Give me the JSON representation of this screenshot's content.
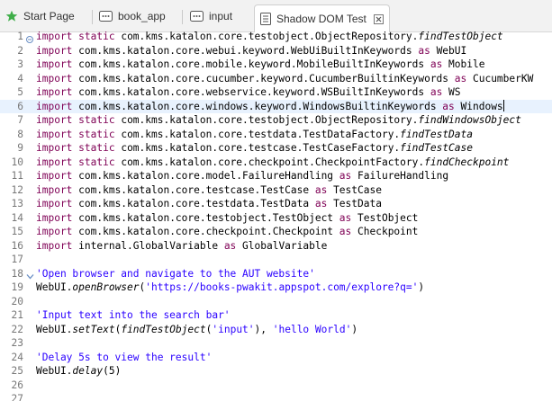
{
  "tabs": [
    {
      "label": "Start Page",
      "icon": "star-icon"
    },
    {
      "label": "book_app",
      "icon": "object-repository-icon"
    },
    {
      "label": "input",
      "icon": "test-object-icon"
    },
    {
      "label": "Shadow DOM Test",
      "icon": "test-case-icon",
      "active": true,
      "close_icon": "close-icon"
    }
  ],
  "editor": {
    "current_line": 6,
    "lines": [
      {
        "n": "1",
        "fold": "collapse",
        "tokens": [
          {
            "t": "import",
            "k": "kw"
          },
          {
            "t": " "
          },
          {
            "t": "static",
            "k": "kw"
          },
          {
            "t": " com.kms.katalon.core.testobject.ObjectRepository."
          },
          {
            "t": "findTestObject",
            "k": "it"
          }
        ]
      },
      {
        "n": "2",
        "tokens": [
          {
            "t": "import",
            "k": "kw"
          },
          {
            "t": " com.kms.katalon.core.webui.keyword.WebUiBuiltInKeywords "
          },
          {
            "t": "as",
            "k": "kw"
          },
          {
            "t": " WebUI"
          }
        ]
      },
      {
        "n": "3",
        "tokens": [
          {
            "t": "import",
            "k": "kw"
          },
          {
            "t": " com.kms.katalon.core.mobile.keyword.MobileBuiltInKeywords "
          },
          {
            "t": "as",
            "k": "kw"
          },
          {
            "t": " Mobile"
          }
        ]
      },
      {
        "n": "4",
        "tokens": [
          {
            "t": "import",
            "k": "kw"
          },
          {
            "t": " com.kms.katalon.core.cucumber.keyword.CucumberBuiltinKeywords "
          },
          {
            "t": "as",
            "k": "kw"
          },
          {
            "t": " CucumberKW"
          }
        ]
      },
      {
        "n": "5",
        "tokens": [
          {
            "t": "import",
            "k": "kw"
          },
          {
            "t": " com.kms.katalon.core.webservice.keyword.WSBuiltInKeywords "
          },
          {
            "t": "as",
            "k": "kw"
          },
          {
            "t": " WS"
          }
        ]
      },
      {
        "n": "6",
        "caret": true,
        "tokens": [
          {
            "t": "import",
            "k": "kw"
          },
          {
            "t": " com.kms.katalon.core.windows.keyword.WindowsBuiltinKeywords "
          },
          {
            "t": "as",
            "k": "kw"
          },
          {
            "t": " Windows"
          }
        ]
      },
      {
        "n": "7",
        "tokens": [
          {
            "t": "import",
            "k": "kw"
          },
          {
            "t": " "
          },
          {
            "t": "static",
            "k": "kw"
          },
          {
            "t": " com.kms.katalon.core.testobject.ObjectRepository."
          },
          {
            "t": "findWindowsObject",
            "k": "it"
          }
        ]
      },
      {
        "n": "8",
        "tokens": [
          {
            "t": "import",
            "k": "kw"
          },
          {
            "t": " "
          },
          {
            "t": "static",
            "k": "kw"
          },
          {
            "t": " com.kms.katalon.core.testdata.TestDataFactory."
          },
          {
            "t": "findTestData",
            "k": "it"
          }
        ]
      },
      {
        "n": "9",
        "tokens": [
          {
            "t": "import",
            "k": "kw"
          },
          {
            "t": " "
          },
          {
            "t": "static",
            "k": "kw"
          },
          {
            "t": " com.kms.katalon.core.testcase.TestCaseFactory."
          },
          {
            "t": "findTestCase",
            "k": "it"
          }
        ]
      },
      {
        "n": "10",
        "tokens": [
          {
            "t": "import",
            "k": "kw"
          },
          {
            "t": " "
          },
          {
            "t": "static",
            "k": "kw"
          },
          {
            "t": " com.kms.katalon.core.checkpoint.CheckpointFactory."
          },
          {
            "t": "findCheckpoint",
            "k": "it"
          }
        ]
      },
      {
        "n": "11",
        "tokens": [
          {
            "t": "import",
            "k": "kw"
          },
          {
            "t": " com.kms.katalon.core.model.FailureHandling "
          },
          {
            "t": "as",
            "k": "kw"
          },
          {
            "t": " FailureHandling"
          }
        ]
      },
      {
        "n": "12",
        "tokens": [
          {
            "t": "import",
            "k": "kw"
          },
          {
            "t": " com.kms.katalon.core.testcase.TestCase "
          },
          {
            "t": "as",
            "k": "kw"
          },
          {
            "t": " TestCase"
          }
        ]
      },
      {
        "n": "13",
        "tokens": [
          {
            "t": "import",
            "k": "kw"
          },
          {
            "t": " com.kms.katalon.core.testdata.TestData "
          },
          {
            "t": "as",
            "k": "kw"
          },
          {
            "t": " TestData"
          }
        ]
      },
      {
        "n": "14",
        "tokens": [
          {
            "t": "import",
            "k": "kw"
          },
          {
            "t": " com.kms.katalon.core.testobject.TestObject "
          },
          {
            "t": "as",
            "k": "kw"
          },
          {
            "t": " TestObject"
          }
        ]
      },
      {
        "n": "15",
        "tokens": [
          {
            "t": "import",
            "k": "kw"
          },
          {
            "t": " com.kms.katalon.core.checkpoint.Checkpoint "
          },
          {
            "t": "as",
            "k": "kw"
          },
          {
            "t": " Checkpoint"
          }
        ]
      },
      {
        "n": "16",
        "tokens": [
          {
            "t": "import",
            "k": "kw"
          },
          {
            "t": " internal.GlobalVariable "
          },
          {
            "t": "as",
            "k": "kw"
          },
          {
            "t": " GlobalVariable"
          }
        ]
      },
      {
        "n": "17",
        "tokens": []
      },
      {
        "n": "18",
        "fold": "expand",
        "tokens": [
          {
            "t": "'Open browser and navigate to the AUT website'",
            "k": "str"
          }
        ]
      },
      {
        "n": "19",
        "tokens": [
          {
            "t": "WebUI."
          },
          {
            "t": "openBrowser",
            "k": "it"
          },
          {
            "t": "("
          },
          {
            "t": "'https://books-pwakit.appspot.com/explore?q='",
            "k": "str"
          },
          {
            "t": ")"
          }
        ]
      },
      {
        "n": "20",
        "tokens": []
      },
      {
        "n": "21",
        "tokens": [
          {
            "t": "'Input text into the search bar'",
            "k": "str"
          }
        ]
      },
      {
        "n": "22",
        "tokens": [
          {
            "t": "WebUI."
          },
          {
            "t": "setText",
            "k": "it"
          },
          {
            "t": "("
          },
          {
            "t": "findTestObject",
            "k": "it"
          },
          {
            "t": "("
          },
          {
            "t": "'input'",
            "k": "str"
          },
          {
            "t": "), "
          },
          {
            "t": "'hello World'",
            "k": "str"
          },
          {
            "t": ")"
          }
        ]
      },
      {
        "n": "23",
        "tokens": []
      },
      {
        "n": "24",
        "tokens": [
          {
            "t": "'Delay 5s to view the result'",
            "k": "str"
          }
        ]
      },
      {
        "n": "25",
        "tokens": [
          {
            "t": "WebUI."
          },
          {
            "t": "delay",
            "k": "it"
          },
          {
            "t": "(5)"
          }
        ]
      },
      {
        "n": "26",
        "tokens": []
      },
      {
        "n": "27",
        "tokens": []
      }
    ]
  },
  "colors": {
    "keyword": "#7f0055",
    "string": "#2a00ff",
    "line_number": "#787878",
    "current_line_bg": "#e8f2fe",
    "tab_bar_bg": "#f2f2f2"
  }
}
